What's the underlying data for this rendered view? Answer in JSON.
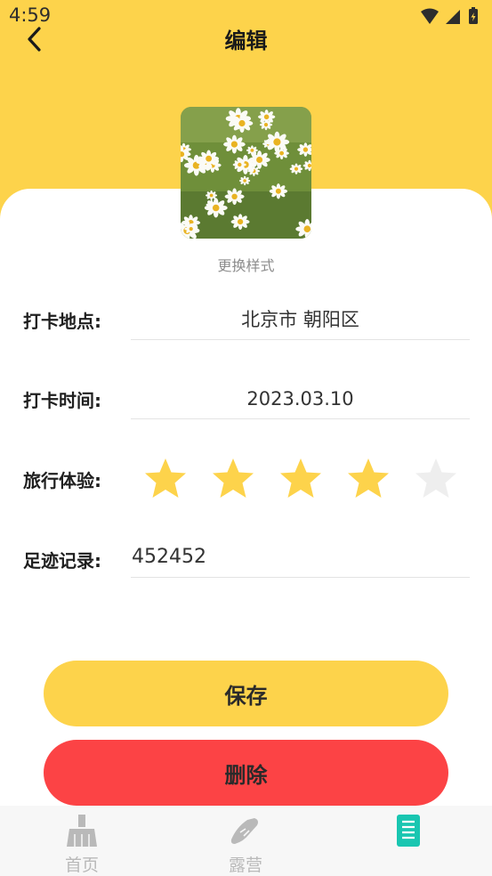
{
  "status_bar": {
    "time": "4:59"
  },
  "header": {
    "title": "编辑"
  },
  "photo": {
    "change_style_label": "更换样式"
  },
  "form": {
    "location": {
      "label": "打卡地点:",
      "value": "北京市 朝阳区"
    },
    "time": {
      "label": "打卡时间:",
      "value": "2023.03.10"
    },
    "rating": {
      "label": "旅行体验:",
      "value": 4,
      "max": 5
    },
    "notes": {
      "label": "足迹记录:",
      "value": "452452"
    }
  },
  "buttons": {
    "save_label": "保存",
    "delete_label": "删除"
  },
  "tabbar": {
    "items": [
      {
        "label": "首页",
        "icon": "broom-icon"
      },
      {
        "label": "露营",
        "icon": "shoe-icon"
      },
      {
        "label": "",
        "icon": "notes-icon",
        "active": true
      }
    ]
  },
  "colors": {
    "accent": "#fdd34b",
    "danger": "#fc4345",
    "star_filled": "#fdd34b",
    "star_empty": "#eeeeee",
    "active_tab": "#19c6b1"
  }
}
